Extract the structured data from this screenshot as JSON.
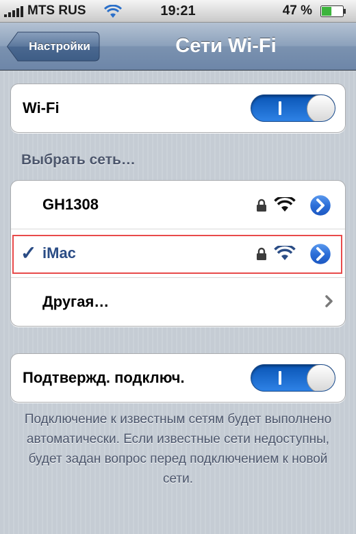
{
  "status_bar": {
    "carrier": "MTS RUS",
    "time": "19:21",
    "battery_percent": "47 %",
    "battery_level": 0.47,
    "signal_bars": 5
  },
  "nav": {
    "back_label": "Настройки",
    "title": "Сети Wi-Fi"
  },
  "wifi_toggle": {
    "label": "Wi-Fi",
    "state": "on"
  },
  "section_header": "Выбрать сеть…",
  "networks": [
    {
      "name": "GH1308",
      "secured": true,
      "connected": false
    },
    {
      "name": "iMac",
      "secured": true,
      "connected": true,
      "checkmark": "✓"
    }
  ],
  "other_network": {
    "label": "Другая…"
  },
  "ask_toggle": {
    "label": "Подтвержд. подключ.",
    "state": "on"
  },
  "footer": "Подключение к известным сетям будет выполнено автоматически. Если известные сети недоступны, будет задан вопрос перед подключением к новой сети.",
  "colors": {
    "nav_blue": "#6d86a8",
    "toggle_blue": "#2e82e6",
    "selected_text": "#2a4c85",
    "highlight": "#e84a4a"
  }
}
